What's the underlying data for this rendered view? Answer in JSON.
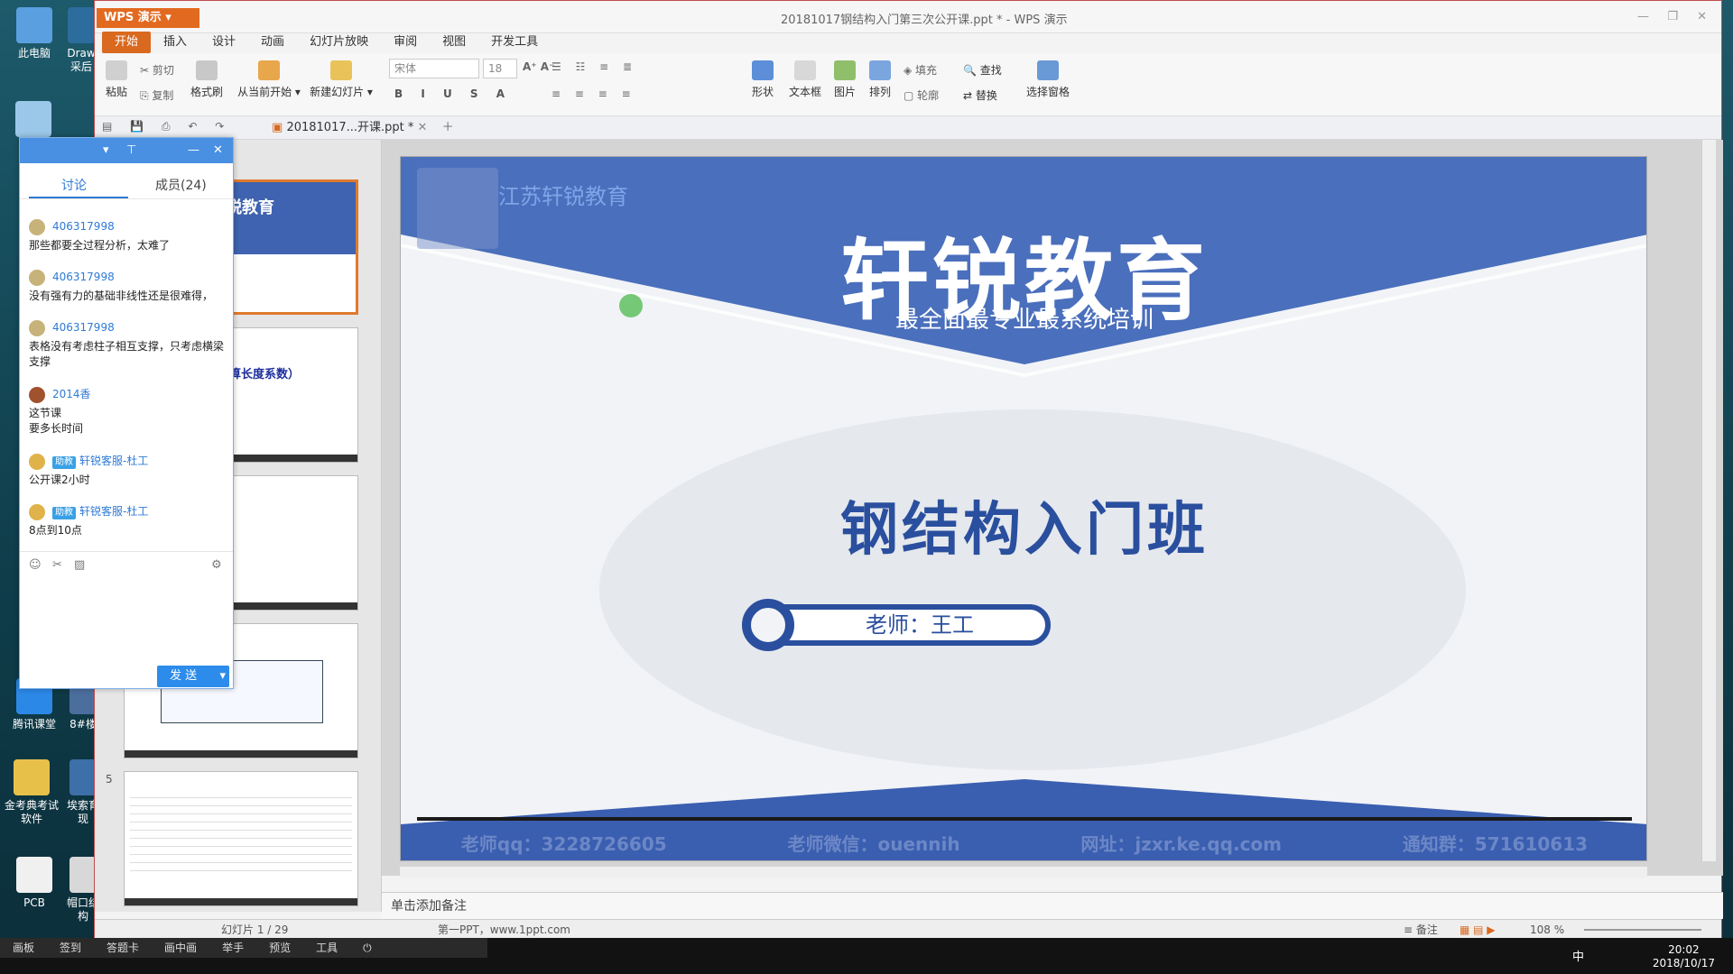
{
  "desktop": {
    "icons": [
      {
        "label": "此电脑"
      },
      {
        "label": "Draw\n采后"
      },
      {
        "label": "腾讯课堂"
      },
      {
        "label": "8#楼"
      },
      {
        "label": "金考典考试软件"
      },
      {
        "label": "埃索育现"
      },
      {
        "label": "PCB"
      },
      {
        "label": "帽口结构"
      }
    ]
  },
  "wps": {
    "app_button": "WPS 演示",
    "doc_title": "20181017钢结构入门第三次公开课.ppt * - WPS 演示",
    "tabs": [
      "开始",
      "插入",
      "设计",
      "动画",
      "幻灯片放映",
      "审阅",
      "视图",
      "开发工具"
    ],
    "ribbon": {
      "paste": "粘贴",
      "cut": "剪切",
      "copy": "复制",
      "format_painter": "格式刷",
      "from_current": "从当前开始",
      "new_slide": "新建幻灯片",
      "font_name": "宋体",
      "font_size": "18",
      "shape": "形状",
      "textbox": "文本框",
      "picture": "图片",
      "arrange": "排列",
      "fill": "填充",
      "outline": "轮廓",
      "find": "查找",
      "replace": "替换",
      "select_pane": "选择窗格"
    },
    "doc_tab": "20181017...开课.ppt *",
    "thumb_number": "5",
    "slide": {
      "logo_text": "江苏轩锐教育",
      "logo_mark": "轩锐教育",
      "title": "轩锐教育",
      "subtitle": "最全面最专业最系统培训",
      "course": "钢结构入门班",
      "teacher": "老师：王工",
      "footer_items": [
        "老师qq：3228726605",
        "老师微信：ouennih",
        "网址：jzxr.ke.qq.com",
        "通知群：571610613"
      ]
    },
    "notes_placeholder": "单击添加备注",
    "status": {
      "slide_count": "幻灯片 1 / 29",
      "theme": "第一PPT，www.1ppt.com",
      "notes": "备注",
      "zoom": "108 %"
    }
  },
  "chat": {
    "tab_discussion": "讨论",
    "tab_members": "成员(24)",
    "messages": [
      {
        "name": "406317998",
        "text": "那些都要全过程分析，太难了"
      },
      {
        "name": "406317998",
        "text": "没有强有力的基础非线性还是很难得，"
      },
      {
        "name": "406317998",
        "text": "表格没有考虑柱子相互支撑，只考虑横梁支撑"
      },
      {
        "name": "2014香",
        "text": "这节课\n要多长时间"
      },
      {
        "name": "轩锐客服-杜工",
        "badge": "助教",
        "text": "公开课2小时"
      },
      {
        "name": "轩锐客服-杜工",
        "badge": "助教",
        "text": "8点到10点"
      }
    ],
    "send_button": "发 送"
  },
  "taskbar": {
    "menu_items": [
      "画板",
      "签到",
      "答题卡",
      "画中画",
      "举手",
      "预览",
      "工具"
    ],
    "time": "20:02",
    "date": "2018/10/17",
    "ime": "中"
  },
  "colors": {
    "slide_blue": "#3f63b0",
    "title_blue": "#2a4f9e",
    "wps_orange": "#d9691f",
    "chat_blue": "#4a90e2"
  }
}
